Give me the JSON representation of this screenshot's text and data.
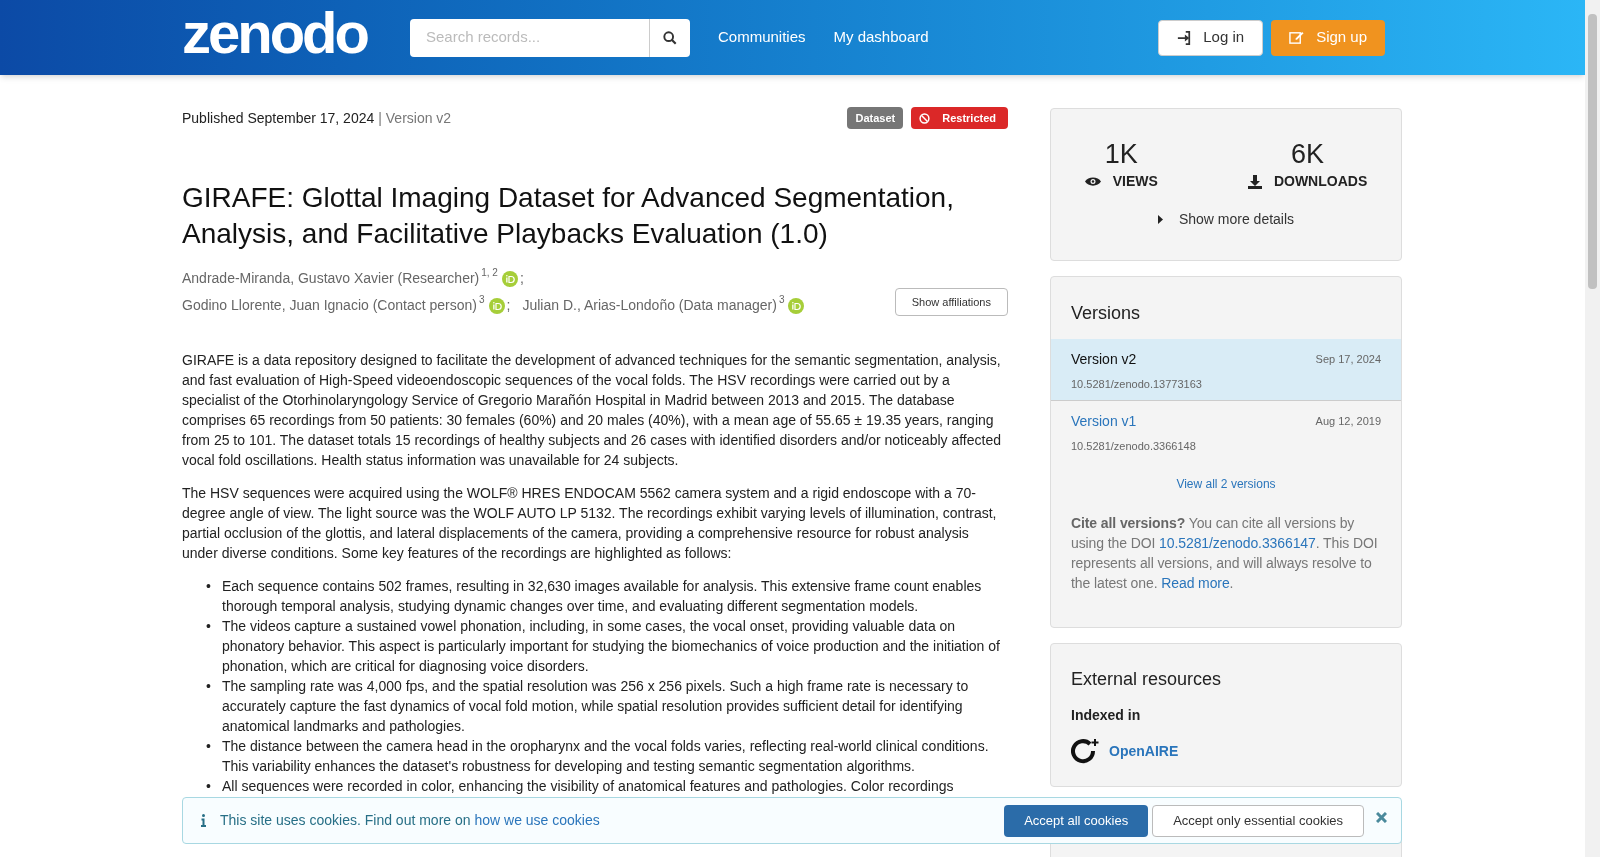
{
  "header": {
    "logo": "zenodo",
    "search": {
      "placeholder": "Search records..."
    },
    "nav": [
      "Communities",
      "My dashboard"
    ],
    "login": "Log in",
    "signup": "Sign up"
  },
  "record": {
    "published": "Published September 17, 2024",
    "version": "| Version v2",
    "badges": [
      {
        "label": "Dataset",
        "kind": "type"
      },
      {
        "label": "Restricted",
        "kind": "access"
      }
    ],
    "title": "GIRAFE: Glottal Imaging Dataset for Advanced Segmentation, Analysis, and Facilitative Playbacks Evaluation (1.0)",
    "creators": [
      [
        {
          "name": "Andrade-Miranda, Gustavo Xavier (Researcher)",
          "aff": "1, 2",
          "sep": ";"
        }
      ],
      [
        {
          "name": "Godino Llorente, Juan Ignacio (Contact person)",
          "aff": "3",
          "sep": ";"
        },
        {
          "name": "Julian D., Arias-Londoño (Data manager)",
          "aff": "3"
        }
      ]
    ],
    "bullet_marker": "•",
    "show_affiliations": "Show affiliations",
    "paragraphs": [
      "GIRAFE is a data repository designed to facilitate the development of advanced techniques for the semantic segmentation, analysis, and fast evaluation of High-Speed videoendoscopic sequences of the vocal folds. The HSV recordings were carried out by a specialist of the Otorhinolaryngology Service of Gregorio Marañón Hospital in Madrid between 2013 and 2015. The database comprises 65 recordings from 50 patients: 30 females (60%) and 20 males (40%), with a mean age of 55.65 ± 19.35 years, ranging from 25 to 101. The dataset totals 15 recordings of healthy subjects and 26 cases with identified disorders and/or noticeably affected vocal fold oscillations. Health status information was unavailable for 24 subjects.",
      "The HSV sequences were acquired using the WOLF® HRES ENDOCAM 5562 camera system and a rigid endoscope with a 70-degree angle of view. The light source was the WOLF AUTO LP 5132. The recordings exhibit varying levels of illumination, contrast, partial occlusion of the glottis, and lateral displacements of the camera, providing a comprehensive resource for robust analysis under diverse conditions. Some key features of the recordings are highlighted as follows:"
    ],
    "bullets": [
      "Each sequence contains 502 frames, resulting in 32,630 images available for analysis. This extensive frame count enables thorough temporal analysis, studying dynamic changes over time, and evaluating different segmentation models.",
      "The videos capture a sustained vowel phonation, including, in some cases, the vocal onset, providing valuable data on phonatory behavior. This aspect is particularly important for studying the biomechanics of voice production and the initiation of phonation, which are critical for diagnosing voice disorders.",
      "The sampling rate was 4,000 fps, and the spatial resolution was 256 x 256 pixels. Such a high frame rate is necessary to accurately capture the fast dynamics of vocal fold motion, while spatial resolution provides sufficient detail for identifying anatomical landmarks and pathologies.",
      "The distance between the camera head in the oropharynx and the vocal folds varies, reflecting real-world clinical conditions. This variability enhances the dataset's robustness for developing and testing semantic segmentation algorithms.",
      "All sequences were recorded in color, enhancing the visibility of anatomical features and pathologies. Color recordings"
    ]
  },
  "stats": {
    "views": "1K",
    "views_label": "VIEWS",
    "downloads": "6K",
    "downloads_label": "DOWNLOADS",
    "more": "Show more details"
  },
  "versions": {
    "title": "Versions",
    "items": [
      {
        "label": "Version v2",
        "date": "Sep 17, 2024",
        "doi": "10.5281/zenodo.13773163",
        "selected": true
      },
      {
        "label": "Version v1",
        "date": "Aug 12, 2019",
        "doi": "10.5281/zenodo.3366148",
        "selected": false
      }
    ],
    "view_all": "View all 2 versions",
    "cite_bold": "Cite all versions?",
    "cite_text": " You can cite all versions by using the DOI ",
    "cite_doi": "10.5281/zenodo.3366147",
    "cite_text2": ". This DOI represents all versions, and will always resolve to the latest one. ",
    "read_more": "Read more",
    "cite_end": "."
  },
  "external": {
    "title": "External resources",
    "indexed": "Indexed in",
    "link": "OpenAIRE"
  },
  "cookies": {
    "text": "This site uses cookies. Find out more on ",
    "link": "how we use cookies",
    "accept_all": "Accept all cookies",
    "accept_essential": "Accept only essential cookies"
  }
}
